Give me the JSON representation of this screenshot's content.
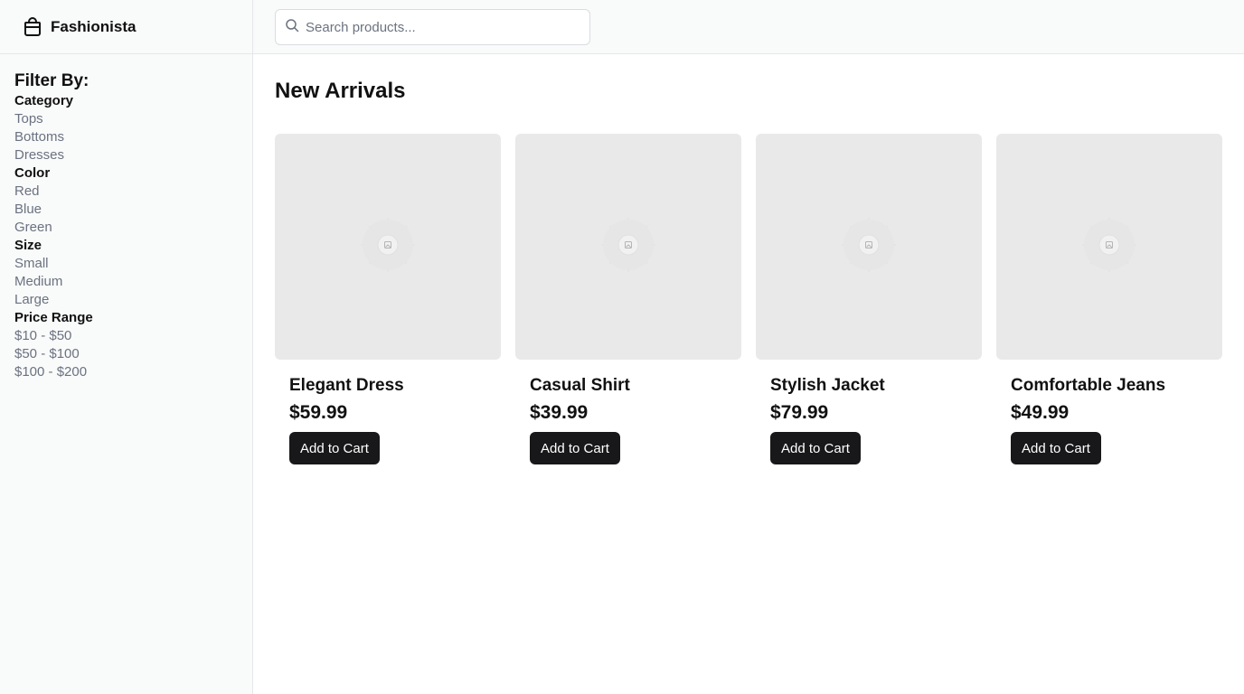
{
  "brand": {
    "name": "Fashionista",
    "icon": "shopping-bag-icon"
  },
  "search": {
    "placeholder": "Search products...",
    "value": ""
  },
  "filters": {
    "heading": "Filter By:",
    "groups": [
      {
        "title": "Category",
        "options": [
          "Tops",
          "Bottoms",
          "Dresses"
        ]
      },
      {
        "title": "Color",
        "options": [
          "Red",
          "Blue",
          "Green"
        ]
      },
      {
        "title": "Size",
        "options": [
          "Small",
          "Medium",
          "Large"
        ]
      },
      {
        "title": "Price Range",
        "options": [
          "$10 - $50",
          "$50 - $100",
          "$100 - $200"
        ]
      }
    ]
  },
  "main": {
    "title": "New Arrivals",
    "products": [
      {
        "name": "Elegant Dress",
        "price": "$59.99",
        "button": "Add to Cart"
      },
      {
        "name": "Casual Shirt",
        "price": "$39.99",
        "button": "Add to Cart"
      },
      {
        "name": "Stylish Jacket",
        "price": "$79.99",
        "button": "Add to Cart"
      },
      {
        "name": "Comfortable Jeans",
        "price": "$49.99",
        "button": "Add to Cart"
      }
    ]
  },
  "colors": {
    "sidebar_bg": "#f9fafa",
    "muted_text": "#6b7280",
    "button_bg": "#18181b",
    "placeholder_bg": "#e9e9e9"
  }
}
